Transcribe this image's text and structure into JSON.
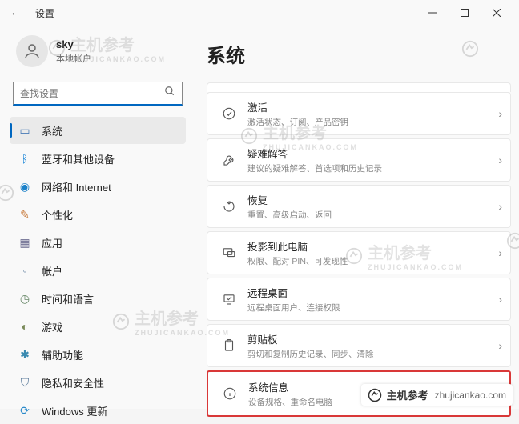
{
  "window": {
    "title": "设置"
  },
  "user": {
    "name": "sky",
    "type": "本地帐户"
  },
  "search": {
    "placeholder": "查找设置"
  },
  "nav": {
    "items": [
      {
        "label": "系统"
      },
      {
        "label": "蓝牙和其他设备"
      },
      {
        "label": "网络和 Internet"
      },
      {
        "label": "个性化"
      },
      {
        "label": "应用"
      },
      {
        "label": "帐户"
      },
      {
        "label": "时间和语言"
      },
      {
        "label": "游戏"
      },
      {
        "label": "辅助功能"
      },
      {
        "label": "隐私和安全性"
      },
      {
        "label": "Windows 更新"
      }
    ]
  },
  "main": {
    "heading": "系统",
    "panels": [
      {
        "title": "激活",
        "desc": "激活状态、订阅、产品密钥"
      },
      {
        "title": "疑难解答",
        "desc": "建议的疑难解答、首选项和历史记录"
      },
      {
        "title": "恢复",
        "desc": "重置、高级启动、返回"
      },
      {
        "title": "投影到此电脑",
        "desc": "权限、配对 PIN、可发现性"
      },
      {
        "title": "远程桌面",
        "desc": "远程桌面用户、连接权限"
      },
      {
        "title": "剪贴板",
        "desc": "剪切和复制历史记录、同步、清除"
      },
      {
        "title": "系统信息",
        "desc": "设备规格、重命名电脑"
      }
    ]
  },
  "watermark": {
    "text": "主机参考",
    "site": "ZHUJICANKAO.COM",
    "url": "zhujicankao.com"
  }
}
